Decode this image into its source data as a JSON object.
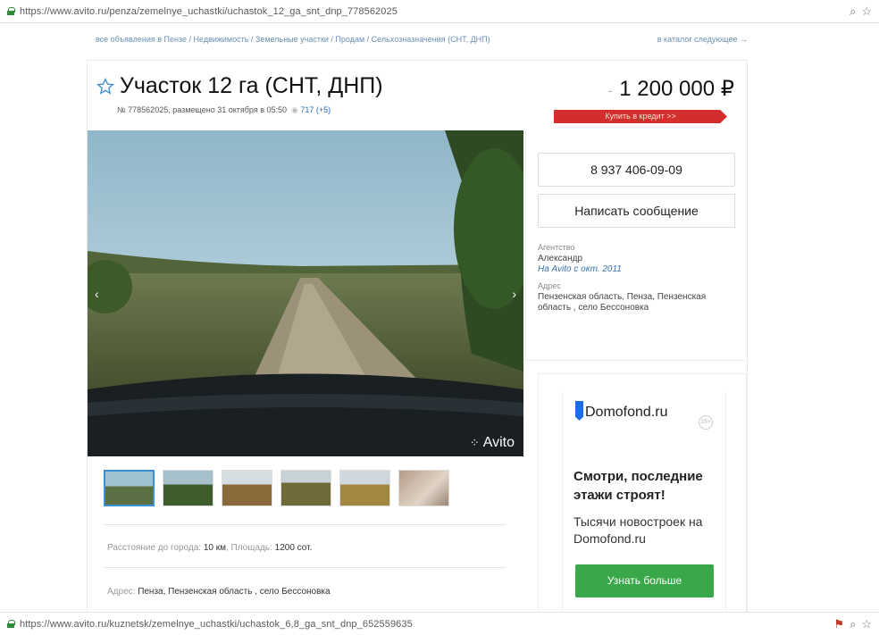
{
  "browser": {
    "top_url": "https://www.avito.ru/penza/zemelnye_uchastki/uchastok_12_ga_snt_dnp_778562025",
    "bottom_url": "https://www.avito.ru/kuznetsk/zemelnye_uchastki/uchastok_6,8_ga_snt_dnp_652559635"
  },
  "breadcrumb": {
    "path": "все объявления в Пензе / Недвижимость / Земельные участки / Продам / Сельхозназначения (СНТ, ДНП)",
    "nav": "в каталог  следующее →"
  },
  "listing": {
    "title": "Участок 12 га (СНТ, ДНП)",
    "meta": "№ 778562025, размещено 31 октября в 05:50",
    "views": "717 (+5)",
    "price": "1 200 000 ₽",
    "credit_label": "Купить в кредит >>",
    "watermark": "Avito",
    "thumbnail_count": 6,
    "distance_label": "Расстояние до города:",
    "distance_value": "10 км",
    "area_label": "Площадь:",
    "area_value": "1200 сот.",
    "address_label": "Адрес:",
    "address_value": "Пенза, Пензенская область , село Бессоновка"
  },
  "seller": {
    "phone": "8 937 406-09-09",
    "message_button": "Написать сообщение",
    "type_label": "Агентство",
    "name": "Александр",
    "since": "На Avito с окт. 2011",
    "address_label": "Адрес",
    "address": "Пензенская область, Пенза, Пензенская область , село Бессоновка"
  },
  "ad": {
    "brand": "Domofond.ru",
    "badge": "16+",
    "headline": "Смотри, последние этажи строят!",
    "subtext": "Тысячи новостроек на Domofond.ru",
    "button": "Узнать больше"
  },
  "colors": {
    "accent_red": "#d32d2d",
    "link_blue": "#2b6fb6",
    "ad_green": "#3aa84a",
    "domofond_blue": "#1c6ee8"
  }
}
